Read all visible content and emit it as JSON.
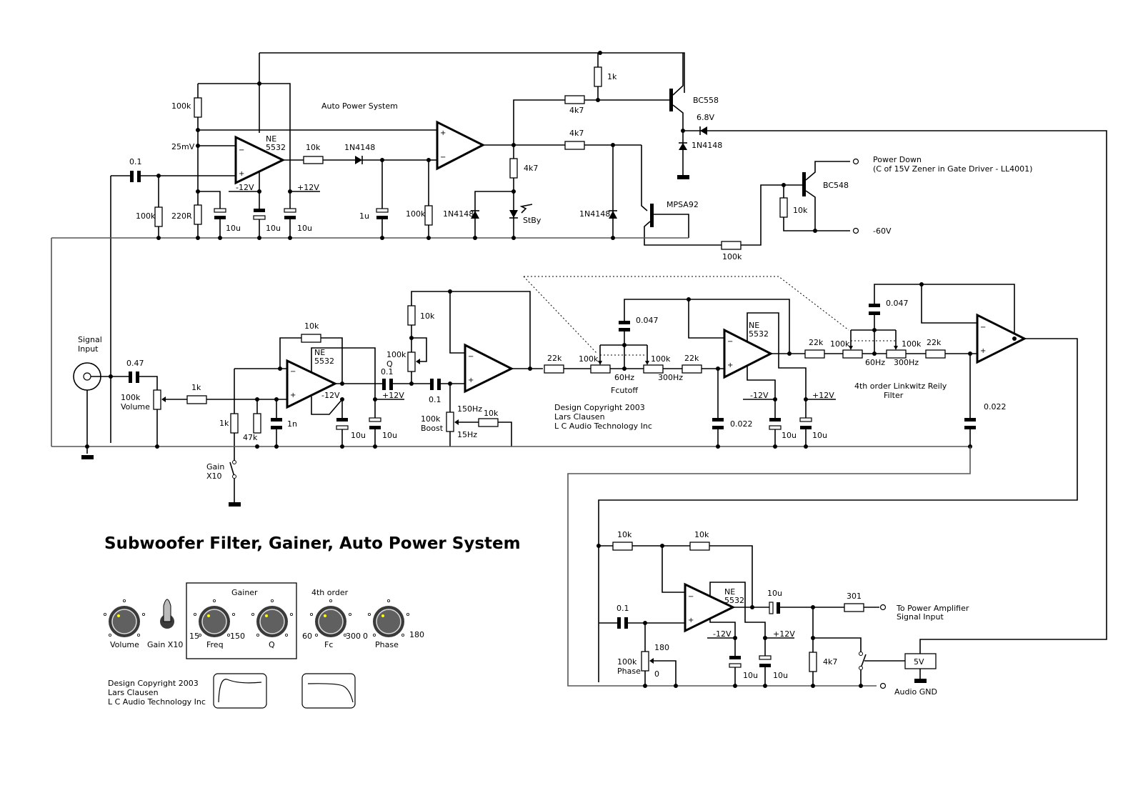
{
  "title": "Subwoofer Filter, Gainer, Auto Power System",
  "sections": {
    "auto_power": "Auto Power System",
    "filter": [
      "4th order Linkwitz Reily",
      "Filter"
    ],
    "fcutoff": "Fcutoff"
  },
  "copyright": [
    "Design Copyright 2003",
    "Lars Clausen",
    "L C Audio Technology Inc"
  ],
  "opamp_label": [
    "NE",
    "5532"
  ],
  "supply": {
    "neg": "-12V",
    "pos": "+12V"
  },
  "auto_power_parts": {
    "r_top": "100k",
    "v_ref": "25mV",
    "c_in": "0.1",
    "r_in": "100k",
    "r_220": "220R",
    "c1": "10u",
    "c2": "10u",
    "c3": "10u",
    "r_out": "10k",
    "diode1": "1N4148",
    "c_1u": "1u",
    "r_100k": "100k",
    "r_4k7_a": "4k7",
    "r_4k7_b": "4k7",
    "r_4k7_c": "4k7",
    "r_1k": "1k",
    "q1": "BC558",
    "zener": "6.8V",
    "diode2": "1N4148",
    "diode3": "1N4148",
    "led": "StBy",
    "diode4": "1N4148",
    "q2": "MPSA92",
    "r_100k_b": "100k",
    "q3": "BC548",
    "r_10k": "10k"
  },
  "terminals": {
    "power_down": [
      "Power Down",
      "(C of 15V Zener in Gate Driver - LL4001)"
    ],
    "neg60": "-60V",
    "to_amp": [
      "To Power Amplifier",
      "Signal Input"
    ],
    "audio_gnd": "Audio GND",
    "signal_input": [
      "Signal",
      "Input"
    ]
  },
  "gainer_parts": {
    "c_in": "0.47",
    "pot_vol": [
      "100k",
      "Volume"
    ],
    "r_1k": "1k",
    "r_1k_b": "1k",
    "r_47k": "47k",
    "c_1n": "1n",
    "r_fb": "10k",
    "c_10u_a": "10u",
    "c_10u_b": "10u",
    "switch": [
      "Gain",
      "X10"
    ],
    "c_01": "0.1",
    "pot_q": [
      "100k",
      "Q"
    ],
    "r_q": "10k",
    "c_01_b": "0.1",
    "pot_boost": [
      "100k",
      "Boost"
    ],
    "hz_high": "150Hz",
    "hz_low": "15Hz",
    "r_boost": "10k"
  },
  "filter_parts": {
    "r22k_a": "22k",
    "pot_a": "100k",
    "pot_b": "100k",
    "r22k_b": "22k",
    "hz60": "60Hz",
    "hz300": "300Hz",
    "c047": "0.047",
    "c022": "0.022",
    "c10u_a": "10u",
    "c10u_b": "10u",
    "r22k_c": "22k",
    "pot_c": "100k",
    "pot_d": "100k",
    "r22k_d": "22k",
    "hz60_b": "60Hz",
    "hz300_b": "300Hz",
    "c047_b": "0.047",
    "c022_b": "0.022"
  },
  "phase_parts": {
    "r10k_a": "10k",
    "r10k_b": "10k",
    "c01": "0.1",
    "pot": [
      "100k",
      "Phase"
    ],
    "p180": "180",
    "p0": "0",
    "c10u_out": "10u",
    "r301": "301",
    "r4k7": "4k7",
    "c10u_a": "10u",
    "c10u_b": "10u",
    "reg": "5V"
  },
  "panel": {
    "gainer_box": "Gainer",
    "order_label": "4th order",
    "controls": [
      {
        "label": "Volume"
      },
      {
        "label": "Gain X10"
      },
      {
        "label": "Freq",
        "min": "15",
        "max": "150"
      },
      {
        "label": "Q"
      },
      {
        "label": "Fc",
        "min": "60",
        "max": "300"
      },
      {
        "label": "Phase",
        "min": "0",
        "max": "180"
      }
    ],
    "knob_indicator_color": "#ffff00"
  }
}
